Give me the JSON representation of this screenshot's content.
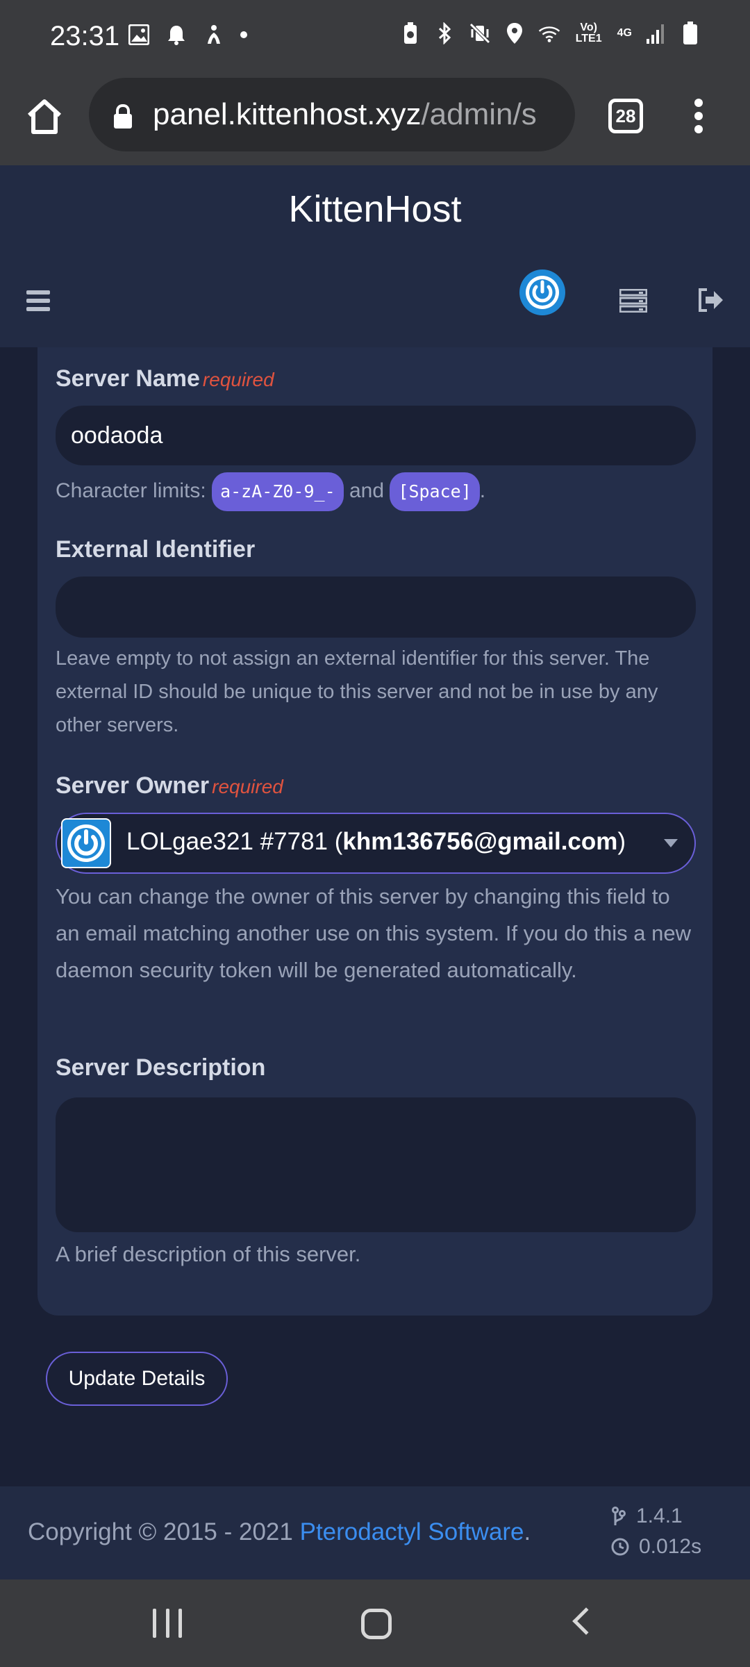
{
  "status_bar": {
    "time": "23:31",
    "left_icons": [
      "gallery-icon",
      "bell-icon",
      "accessibility-icon",
      "dot-icon"
    ],
    "right_icons": [
      "battery-saver-icon",
      "bluetooth-icon",
      "vibrate-off-icon",
      "location-icon",
      "wifi-icon",
      "volte-icon",
      "4g-icon",
      "signal-icon",
      "battery-icon"
    ],
    "volte_label": "Vo) LTE1",
    "network_label": "4G"
  },
  "browser": {
    "url_host": "panel.kittenhost.xyz",
    "url_path": "/admin/s",
    "tab_count": "28"
  },
  "header": {
    "brand": "KittenHost"
  },
  "form": {
    "server_name": {
      "label": "Server Name",
      "required": "required",
      "value": "oodaoda",
      "help_prefix": "Character limits:",
      "help_chars": "a-zA-Z0-9_-",
      "help_and": "and",
      "help_space": "[Space]",
      "help_end": "."
    },
    "external_identifier": {
      "label": "External Identifier",
      "value": "",
      "help": "Leave empty to not assign an external identifier for this server. The external ID should be unique to this server and not be in use by any other servers."
    },
    "server_owner": {
      "label": "Server Owner",
      "required": "required",
      "owner_name": "LOLgae321 #7781 (",
      "owner_email": "khm136756@gmail.com",
      "owner_close": ")",
      "help": "You can change the owner of this server by changing this field to an email matching another use on this system. If you do this a new daemon security token will be generated automatically."
    },
    "server_description": {
      "label": "Server Description",
      "value": "",
      "help": "A brief description of this server."
    },
    "submit_label": "Update Details"
  },
  "footer": {
    "copyright_prefix": "Copyright © 2015 - 2021 ",
    "link_text": "Pterodactyl Software",
    "copyright_suffix": ".",
    "version": "1.4.1",
    "render_time": "0.012s"
  },
  "colors": {
    "accent": "#6a5fd8",
    "required": "#e0533f",
    "link": "#3b8ef0",
    "avatar": "#1e88d6"
  }
}
